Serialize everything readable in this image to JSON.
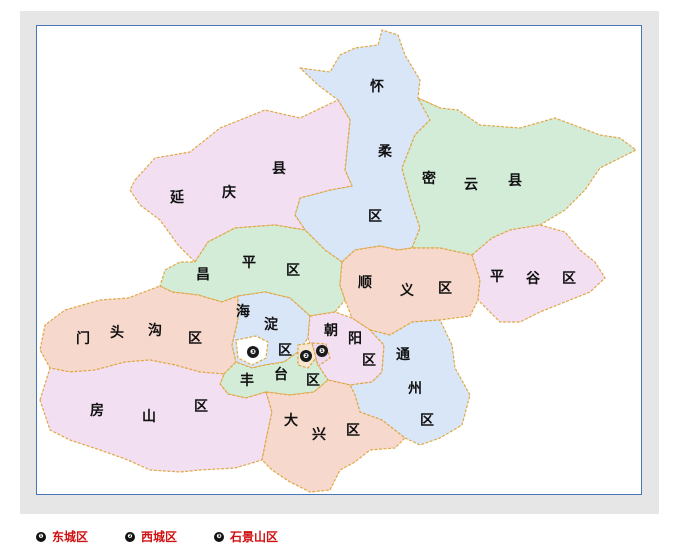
{
  "colors": {
    "pink": "#f2dff2",
    "blue": "#d8e6f8",
    "green": "#d2ecd8",
    "peach": "#f7d8cc",
    "border": "#e0a846",
    "frame_border": "#4a74b8",
    "legend_text": "#d01010"
  },
  "districts": [
    {
      "id": "huairou",
      "name": [
        "怀",
        "柔",
        "区"
      ],
      "color": "blue"
    },
    {
      "id": "miyun",
      "name": [
        "密",
        "云",
        "县"
      ],
      "color": "green"
    },
    {
      "id": "yanqing",
      "name": [
        "延",
        "庆",
        "县"
      ],
      "color": "pink"
    },
    {
      "id": "changping",
      "name": [
        "昌",
        "平",
        "区"
      ],
      "color": "green"
    },
    {
      "id": "shunyi",
      "name": [
        "顺",
        "义",
        "区"
      ],
      "color": "peach"
    },
    {
      "id": "pinggu",
      "name": [
        "平",
        "谷",
        "区"
      ],
      "color": "pink"
    },
    {
      "id": "mentougou",
      "name": [
        "门",
        "头",
        "沟",
        "区"
      ],
      "color": "peach"
    },
    {
      "id": "haidian",
      "name": [
        "海",
        "淀",
        "区"
      ],
      "color": "blue"
    },
    {
      "id": "chaoyang",
      "name": [
        "朝",
        "阳",
        "区"
      ],
      "color": "pink"
    },
    {
      "id": "tongzhou",
      "name": [
        "通",
        "州",
        "区"
      ],
      "color": "blue"
    },
    {
      "id": "fengtai",
      "name": [
        "丰",
        "台",
        "区"
      ],
      "color": "green"
    },
    {
      "id": "fangshan",
      "name": [
        "房",
        "山",
        "区"
      ],
      "color": "pink"
    },
    {
      "id": "daxing",
      "name": [
        "大",
        "兴",
        "区"
      ],
      "color": "peach"
    }
  ],
  "markers": [
    {
      "id": "dongcheng",
      "symbol": "❶"
    },
    {
      "id": "xicheng",
      "symbol": "❷"
    },
    {
      "id": "shijingshan",
      "symbol": "❸"
    }
  ],
  "legend": [
    {
      "symbol": "❶",
      "label": "东城区"
    },
    {
      "symbol": "❷",
      "label": "西城区"
    },
    {
      "symbol": "❸",
      "label": "石景山区"
    }
  ]
}
